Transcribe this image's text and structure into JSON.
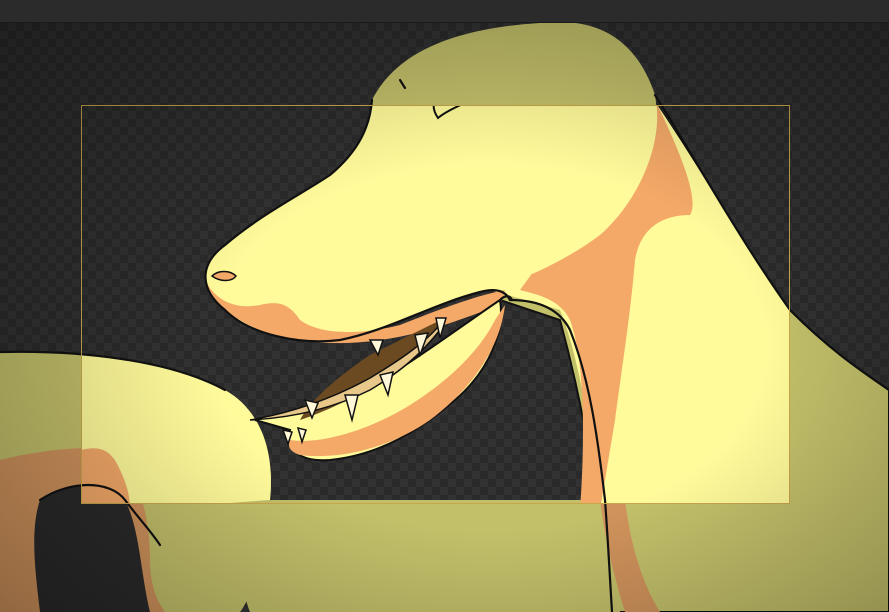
{
  "editor": {
    "top_bar": {},
    "viewport": {
      "background": "checkerboard",
      "camera_frame_color": "#c9a64a"
    },
    "artwork": {
      "subject": "dinosaur-head",
      "palette": {
        "inside_frame_skin": "#fffa9a",
        "outside_frame_skin": "#c3c06a",
        "shadow": "#f4a968",
        "outline": "#111111",
        "mouth_dark": "#6b4a22"
      }
    }
  }
}
